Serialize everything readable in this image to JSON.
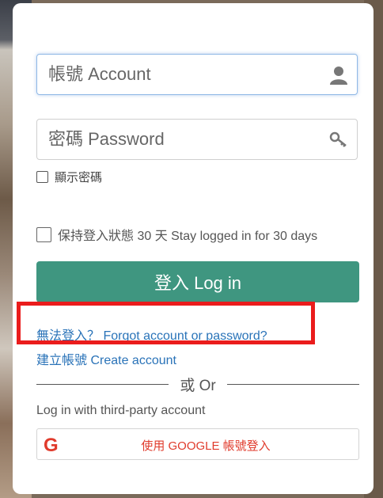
{
  "account": {
    "placeholder": "帳號 Account",
    "icon": "user-icon"
  },
  "password": {
    "placeholder": "密碼 Password",
    "icon": "key-icon"
  },
  "show_password": {
    "label": "顯示密碼",
    "checked": false
  },
  "stay_logged_in": {
    "label": "保持登入狀態 30 天 Stay logged in for 30 days",
    "checked": false
  },
  "login_button": {
    "label": "登入 Log in"
  },
  "forgot_link": {
    "label": "無法登入？ Forgot account or password?"
  },
  "create_link": {
    "label": "建立帳號 Create account"
  },
  "divider": {
    "label": "或 Or"
  },
  "third_party": {
    "label": "Log in with third-party account"
  },
  "google_button": {
    "label": "使用 GOOGLE 帳號登入",
    "icon": "google-icon"
  },
  "colors": {
    "accent": "#3f9680",
    "link": "#2a73b8",
    "google": "#e03b2c",
    "highlight": "#ea1c1c"
  }
}
